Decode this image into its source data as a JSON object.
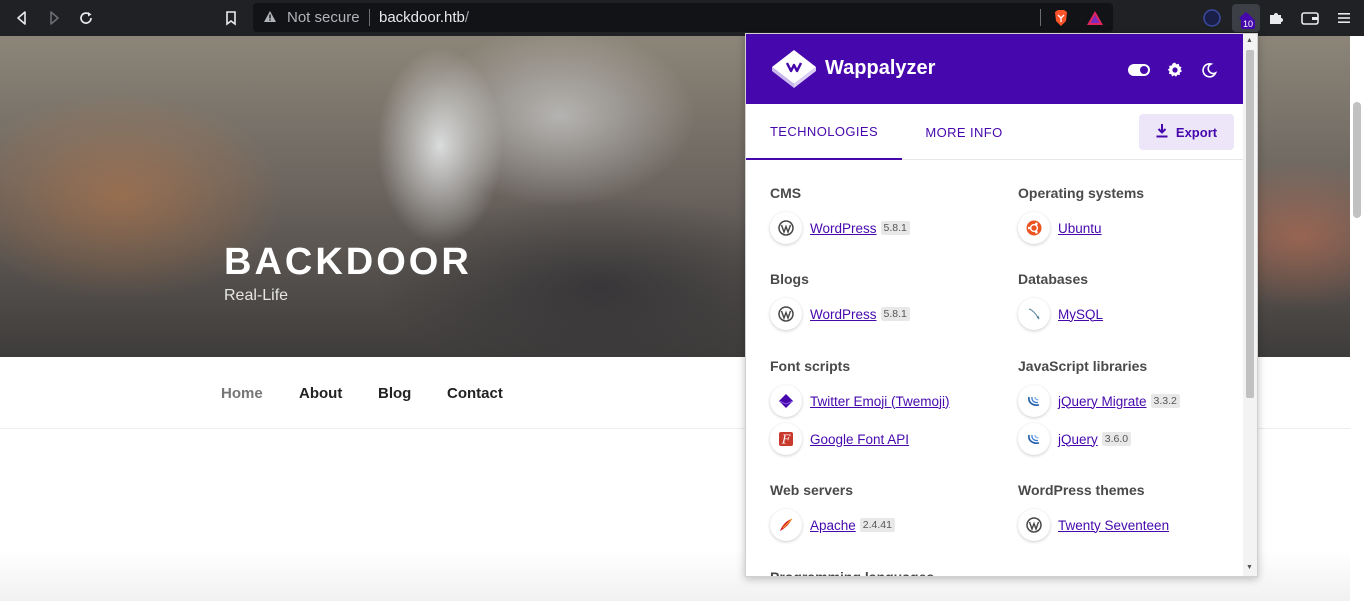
{
  "browser": {
    "url_security": "Not secure",
    "url_host": "backdoor.htb",
    "url_path": "/",
    "extension_badge": "10"
  },
  "site": {
    "title": "BACKDOOR",
    "tagline": "Real-Life",
    "nav": [
      "Home",
      "About",
      "Blog",
      "Contact"
    ],
    "active_nav": "Home"
  },
  "wappalyzer": {
    "brand": "Wappalyzer",
    "tabs": [
      "TECHNOLOGIES",
      "MORE INFO"
    ],
    "active_tab": "TECHNOLOGIES",
    "export_label": "Export",
    "colors": {
      "accent": "#4608ad",
      "export_bg": "#ede6f8"
    },
    "left_categories": [
      {
        "name": "CMS",
        "items": [
          {
            "name": "WordPress",
            "version": "5.8.1",
            "icon": "wordpress-icon"
          }
        ]
      },
      {
        "name": "Blogs",
        "items": [
          {
            "name": "WordPress",
            "version": "5.8.1",
            "icon": "wordpress-icon"
          }
        ]
      },
      {
        "name": "Font scripts",
        "items": [
          {
            "name": "Twitter Emoji (Twemoji)",
            "version": "",
            "icon": "twemoji-icon"
          },
          {
            "name": "Google Font API",
            "version": "",
            "icon": "google-font-icon"
          }
        ]
      },
      {
        "name": "Web servers",
        "items": [
          {
            "name": "Apache",
            "version": "2.4.41",
            "icon": "apache-feather-icon"
          }
        ]
      },
      {
        "name": "Programming languages",
        "items": []
      }
    ],
    "right_categories": [
      {
        "name": "Operating systems",
        "items": [
          {
            "name": "Ubuntu",
            "version": "",
            "icon": "ubuntu-icon"
          }
        ]
      },
      {
        "name": "Databases",
        "items": [
          {
            "name": "MySQL",
            "version": "",
            "icon": "mysql-icon"
          }
        ]
      },
      {
        "name": "JavaScript libraries",
        "items": [
          {
            "name": "jQuery Migrate",
            "version": "3.3.2",
            "icon": "jquery-icon"
          },
          {
            "name": "jQuery",
            "version": "3.6.0",
            "icon": "jquery-icon"
          }
        ]
      },
      {
        "name": "WordPress themes",
        "items": [
          {
            "name": "Twenty Seventeen",
            "version": "",
            "icon": "wordpress-icon"
          }
        ]
      }
    ]
  }
}
